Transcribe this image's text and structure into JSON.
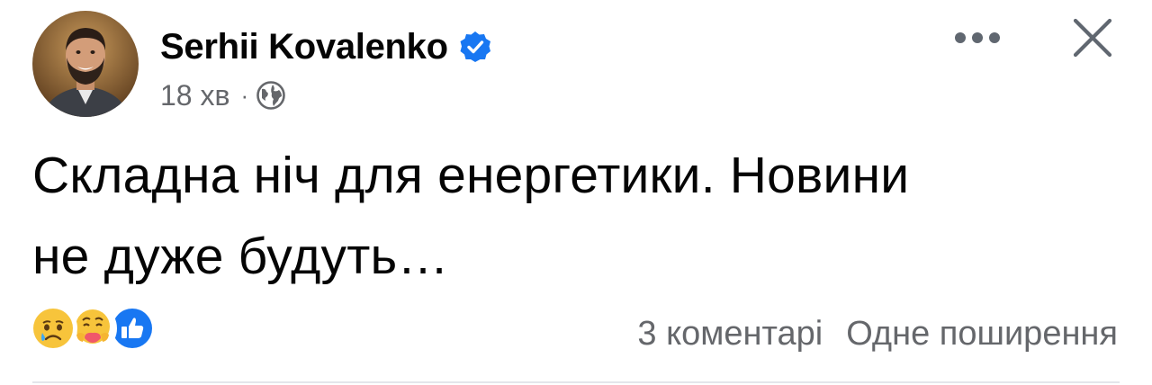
{
  "post": {
    "author": {
      "name": "Serhii Kovalenko",
      "verified": true
    },
    "time": "18 хв",
    "separator": "·",
    "audience_icon": "globe-icon",
    "text_lines": [
      "Складна ніч для енергетики. Новини",
      "не дуже будуть…"
    ],
    "reactions": [
      "sad-reaction-icon",
      "care-reaction-icon",
      "like-reaction-icon"
    ],
    "stats": {
      "comments": "3 коментарі",
      "shares": "Одне поширення"
    }
  },
  "colors": {
    "text": "#050505",
    "secondary": "#65676b",
    "brand_blue": "#1877f2",
    "divider": "#e4e6eb"
  }
}
